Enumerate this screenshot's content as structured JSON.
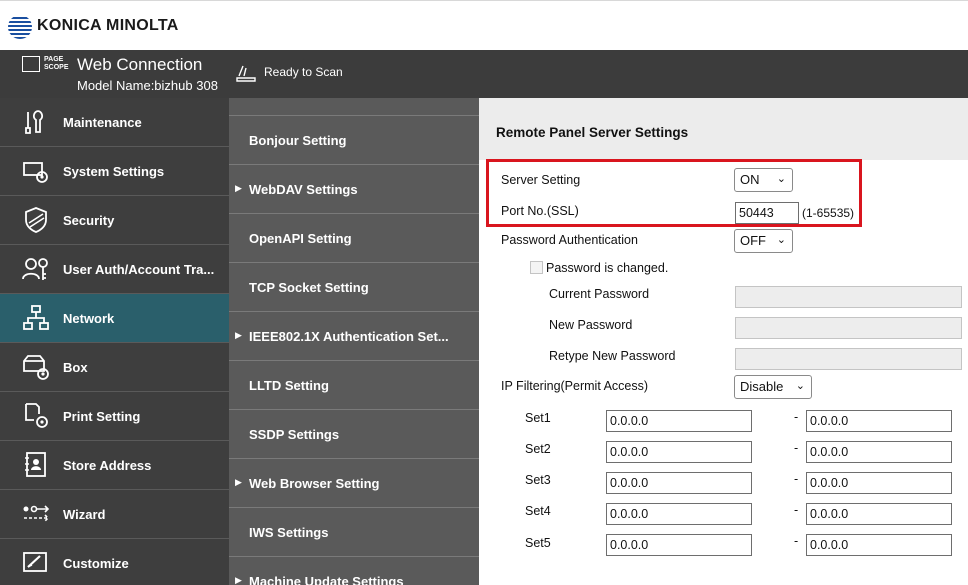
{
  "brand": {
    "name": "KONICA MINOLTA"
  },
  "header": {
    "logo_text": "PAGE SCOPE",
    "app_title": "Web Connection",
    "model": "Model Name:bizhub 308",
    "status": "Ready to Scan"
  },
  "sidebar": {
    "items": [
      {
        "label": "Maintenance",
        "icon": "maintenance-icon"
      },
      {
        "label": "System Settings",
        "icon": "system-settings-icon"
      },
      {
        "label": "Security",
        "icon": "security-shield-icon"
      },
      {
        "label": "User Auth/Account Tra...",
        "icon": "user-auth-icon"
      },
      {
        "label": "Network",
        "icon": "network-icon",
        "active": true
      },
      {
        "label": "Box",
        "icon": "box-icon"
      },
      {
        "label": "Print Setting",
        "icon": "print-setting-icon"
      },
      {
        "label": "Store Address",
        "icon": "store-address-icon"
      },
      {
        "label": "Wizard",
        "icon": "wizard-icon"
      },
      {
        "label": "Customize",
        "icon": "customize-icon"
      }
    ]
  },
  "submenu": {
    "items": [
      {
        "label": "Bonjour Setting",
        "arrow": ""
      },
      {
        "label": "WebDAV Settings",
        "arrow": "▶"
      },
      {
        "label": "OpenAPI Setting",
        "arrow": ""
      },
      {
        "label": "TCP Socket Setting",
        "arrow": ""
      },
      {
        "label": "IEEE802.1X Authentication Set...",
        "arrow": "▶"
      },
      {
        "label": "LLTD Setting",
        "arrow": ""
      },
      {
        "label": "SSDP Settings",
        "arrow": ""
      },
      {
        "label": "Web Browser Setting",
        "arrow": "▶"
      },
      {
        "label": "IWS Settings",
        "arrow": ""
      },
      {
        "label": "Machine Update Settings",
        "arrow": "▶"
      }
    ]
  },
  "content": {
    "title": "Remote Panel Server Settings",
    "server_setting": {
      "label": "Server Setting",
      "value": "ON"
    },
    "port": {
      "label": "Port No.(SSL)",
      "value": "50443",
      "range": "(1-65535)"
    },
    "password_auth": {
      "label": "Password Authentication",
      "value": "OFF"
    },
    "password_changed": {
      "label": "Password is changed."
    },
    "current_password": {
      "label": "Current Password",
      "value": ""
    },
    "new_password": {
      "label": "New Password",
      "value": ""
    },
    "retype_password": {
      "label": "Retype New Password",
      "value": ""
    },
    "ip_filtering": {
      "label": "IP Filtering(Permit Access)",
      "value": "Disable"
    },
    "ip_sets": [
      {
        "label": "Set1",
        "from": "0.0.0.0",
        "sep": "-",
        "to": "0.0.0.0"
      },
      {
        "label": "Set2",
        "from": "0.0.0.0",
        "sep": "-",
        "to": "0.0.0.0"
      },
      {
        "label": "Set3",
        "from": "0.0.0.0",
        "sep": "-",
        "to": "0.0.0.0"
      },
      {
        "label": "Set4",
        "from": "0.0.0.0",
        "sep": "-",
        "to": "0.0.0.0"
      },
      {
        "label": "Set5",
        "from": "0.0.0.0",
        "sep": "-",
        "to": "0.0.0.0"
      }
    ]
  },
  "colors": {
    "header_bg": "#3c3c3c",
    "sidebar_bg": "#3e3e3e",
    "active_bg": "#2a5f6b",
    "submenu_bg": "#5a5a5a",
    "highlight": "#d9151e",
    "brand_blue": "#1a4fa0"
  }
}
